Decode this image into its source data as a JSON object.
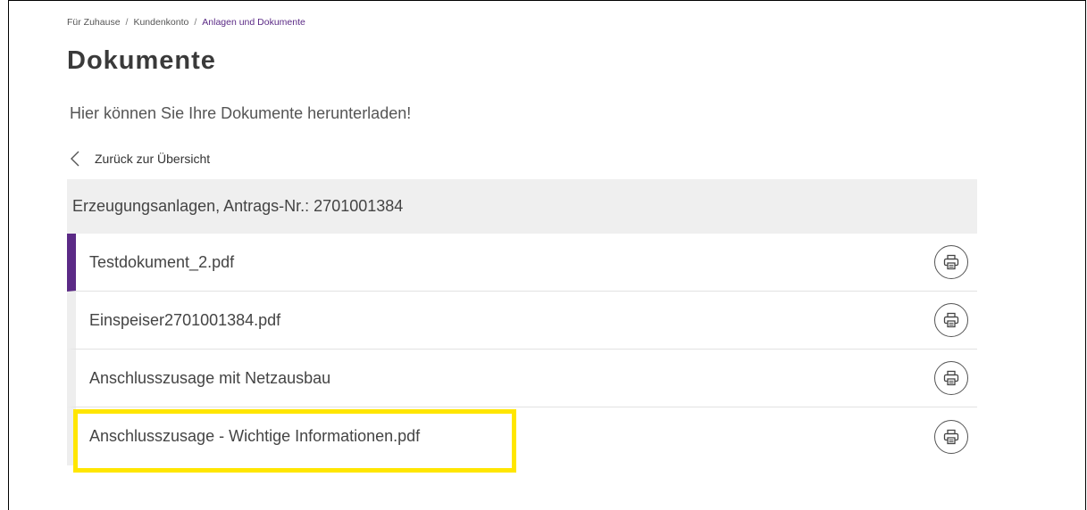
{
  "breadcrumb": {
    "items": [
      "Für Zuhause",
      "Kundenkonto",
      "Anlagen und Dokumente"
    ],
    "separator": "/"
  },
  "page": {
    "title": "Dokumente",
    "subtitle": "Hier können Sie Ihre Dokumente herunterladen!"
  },
  "back_link": {
    "label": "Zurück zur Übersicht",
    "icon": "chevron-left-icon"
  },
  "panel": {
    "header": "Erzeugungsanlagen, Antrags-Nr.: 2701001384",
    "documents": [
      {
        "name": "Testdokument_2.pdf",
        "active": true,
        "action_icon": "printer-icon"
      },
      {
        "name": "Einspeiser2701001384.pdf",
        "active": false,
        "action_icon": "printer-icon"
      },
      {
        "name": "Anschlusszusage mit Netzausbau",
        "active": false,
        "action_icon": "printer-icon"
      },
      {
        "name": "Anschlusszusage - Wichtige Informationen.pdf",
        "active": false,
        "highlighted": true,
        "action_icon": "printer-icon"
      }
    ]
  },
  "colors": {
    "accent": "#5b2a86",
    "highlight": "#ffe600",
    "panel_header_bg": "#efefef"
  }
}
